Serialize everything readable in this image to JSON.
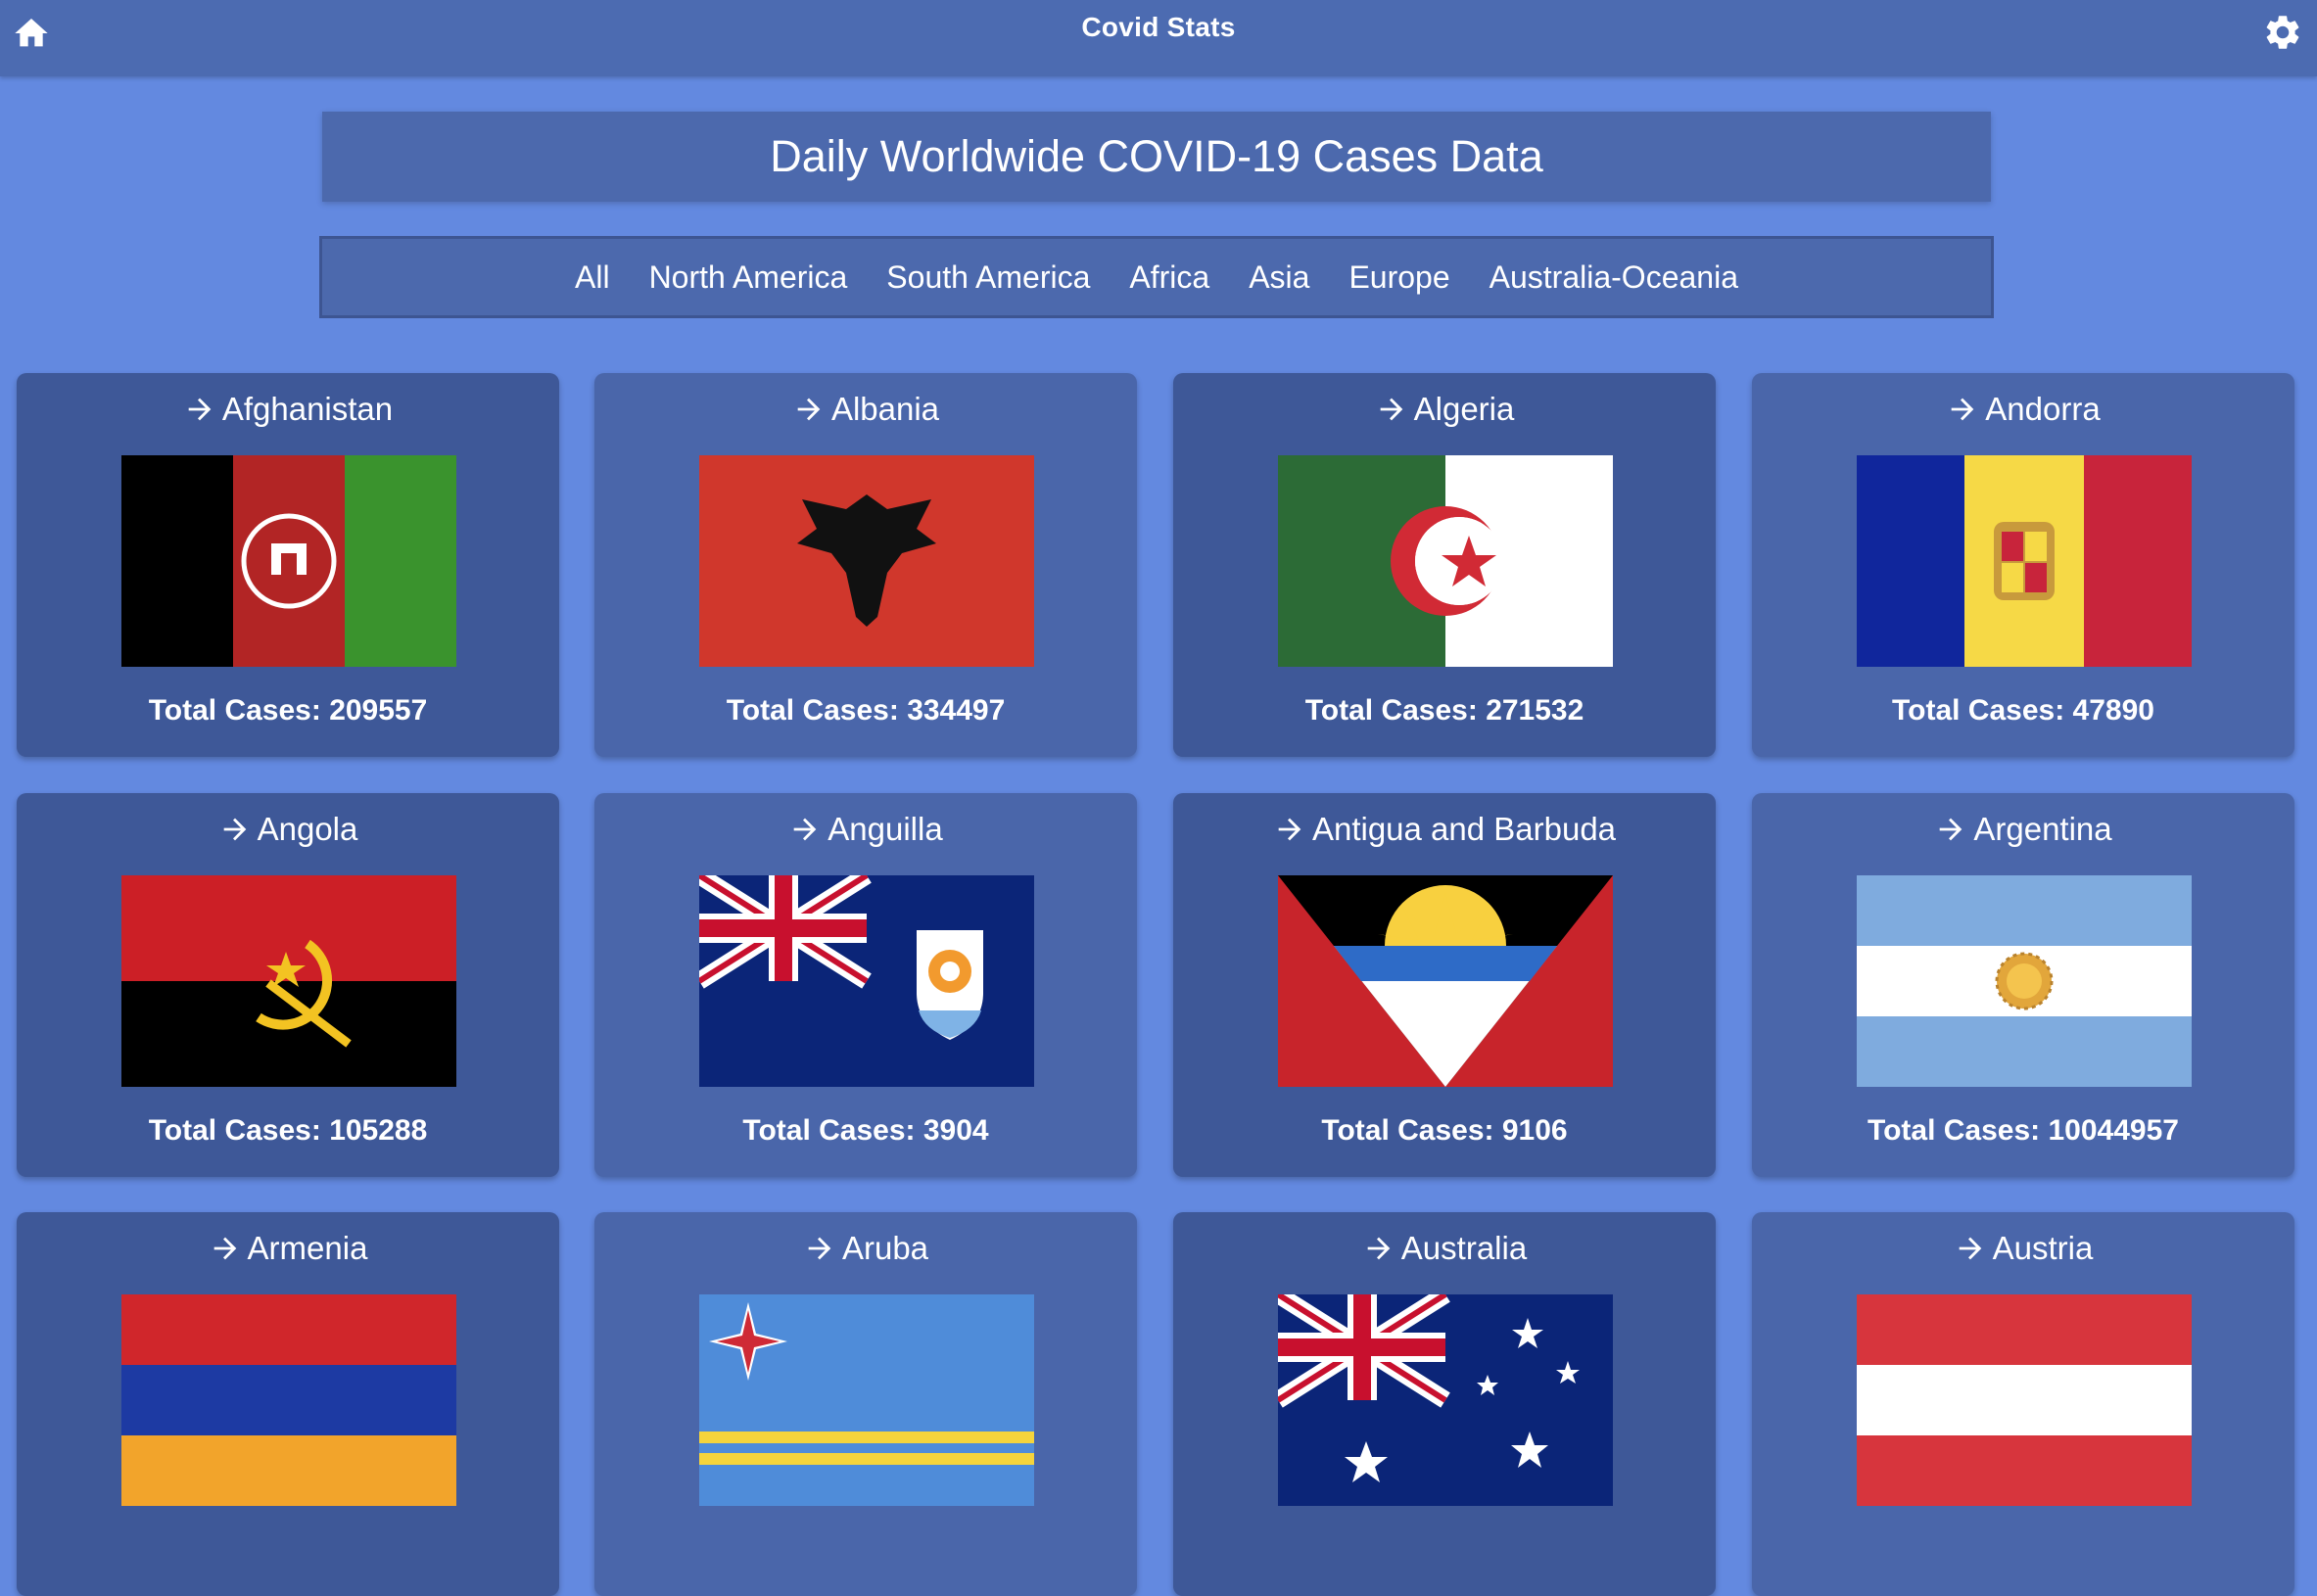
{
  "app": {
    "title": "Covid Stats"
  },
  "banner": {
    "title": "Daily Worldwide COVID-19 Cases Data"
  },
  "filters": [
    "All",
    "North America",
    "South America",
    "Africa",
    "Asia",
    "Europe",
    "Australia-Oceania"
  ],
  "cases_label": "Total Cases: ",
  "countries": [
    {
      "name": "Afghanistan",
      "cases": "209557",
      "flag": "afghanistan-flag"
    },
    {
      "name": "Albania",
      "cases": "334497",
      "flag": "albania-flag"
    },
    {
      "name": "Algeria",
      "cases": "271532",
      "flag": "algeria-flag"
    },
    {
      "name": "Andorra",
      "cases": "47890",
      "flag": "andorra-flag"
    },
    {
      "name": "Angola",
      "cases": "105288",
      "flag": "angola-flag"
    },
    {
      "name": "Anguilla",
      "cases": "3904",
      "flag": "anguilla-flag"
    },
    {
      "name": "Antigua and Barbuda",
      "cases": "9106",
      "flag": "antigua-and-barbuda-flag"
    },
    {
      "name": "Argentina",
      "cases": "10044957",
      "flag": "argentina-flag"
    },
    {
      "name": "Armenia",
      "cases": "",
      "flag": "armenia-flag"
    },
    {
      "name": "Aruba",
      "cases": "",
      "flag": "aruba-flag"
    },
    {
      "name": "Australia",
      "cases": "",
      "flag": "australia-flag"
    },
    {
      "name": "Austria",
      "cases": "",
      "flag": "austria-flag"
    }
  ],
  "icons": {
    "home": "home-icon",
    "settings": "gear-icon",
    "arrow": "arrow-right-icon"
  }
}
